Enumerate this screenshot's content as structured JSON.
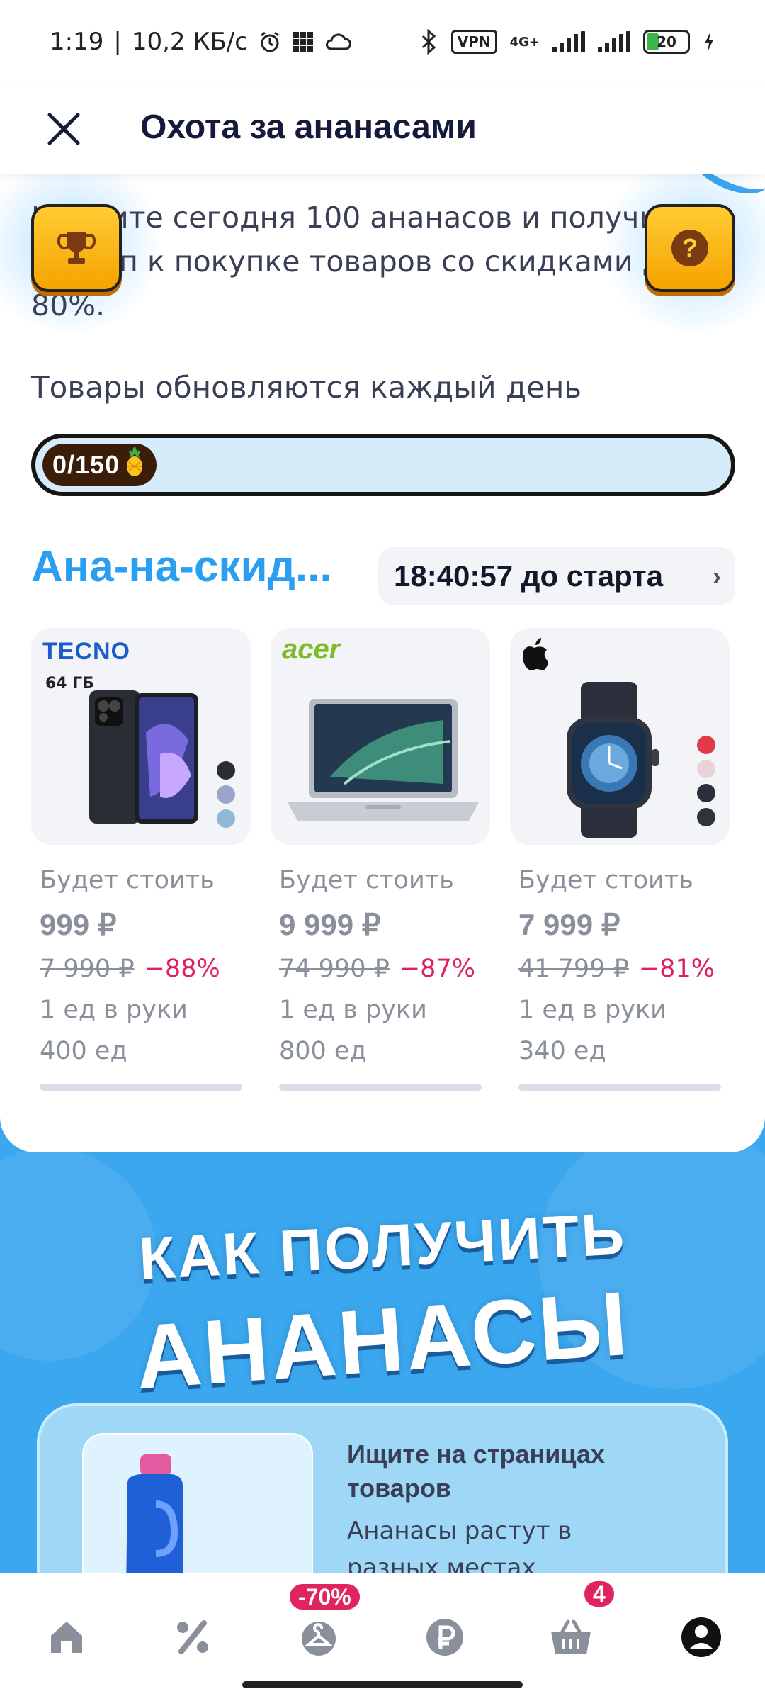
{
  "status_bar": {
    "time": "1:19",
    "separator": "|",
    "speed": "10,2 КБ/с",
    "vpn": "VPN",
    "network": "4G+",
    "battery": "20"
  },
  "header": {
    "title": "Охота за ананасами"
  },
  "intro_text": "Найдите сегодня 100 ананасов и получите доступ к покупке товаров со скидками до 80%.",
  "update_text": "Товары обновляются каждый день",
  "progress": {
    "label": "0/150",
    "current": 0,
    "total": 150
  },
  "section": {
    "title": "Ана-на-скид...",
    "timer": "18:40:57 до старта"
  },
  "products": [
    {
      "brand": "TECNO",
      "sub_brand": "64 ГБ",
      "will_cost": "Будет стоить",
      "price": "999 ₽",
      "old_price": "7 990 ₽",
      "discount": "−88%",
      "limit": "1 ед в руки",
      "stock": "400 ед"
    },
    {
      "brand": "acer",
      "sub_brand": "",
      "will_cost": "Будет стоить",
      "price": "9 999 ₽",
      "old_price": "74 990 ₽",
      "discount": "−87%",
      "limit": "1 ед в руки",
      "stock": "800 ед"
    },
    {
      "brand": "",
      "sub_brand": "",
      "will_cost": "Будет стоить",
      "price": "7 999 ₽",
      "old_price": "41 799 ₽",
      "discount": "−81%",
      "limit": "1 ед в руки",
      "stock": "340 ед"
    }
  ],
  "promo": {
    "title_line1": "КАК ПОЛУЧИТЬ",
    "title_line2": "АНАНАСЫ",
    "card_title": "Ищите на страницах товаров",
    "card_desc": "Ананасы растут в разных местах"
  },
  "bottom_nav": {
    "items": [
      {
        "icon": "home-icon"
      },
      {
        "icon": "percent-icon"
      },
      {
        "icon": "hanger-icon",
        "badge": "-70%"
      },
      {
        "icon": "ruble-icon"
      },
      {
        "icon": "cart-icon",
        "badge": "4"
      },
      {
        "icon": "profile-icon"
      }
    ]
  },
  "colors": {
    "accent_blue": "#2a9ef0",
    "discount_red": "#e01e63",
    "promo_bg": "#3aa7ef",
    "title_dark": "#151a3a"
  }
}
